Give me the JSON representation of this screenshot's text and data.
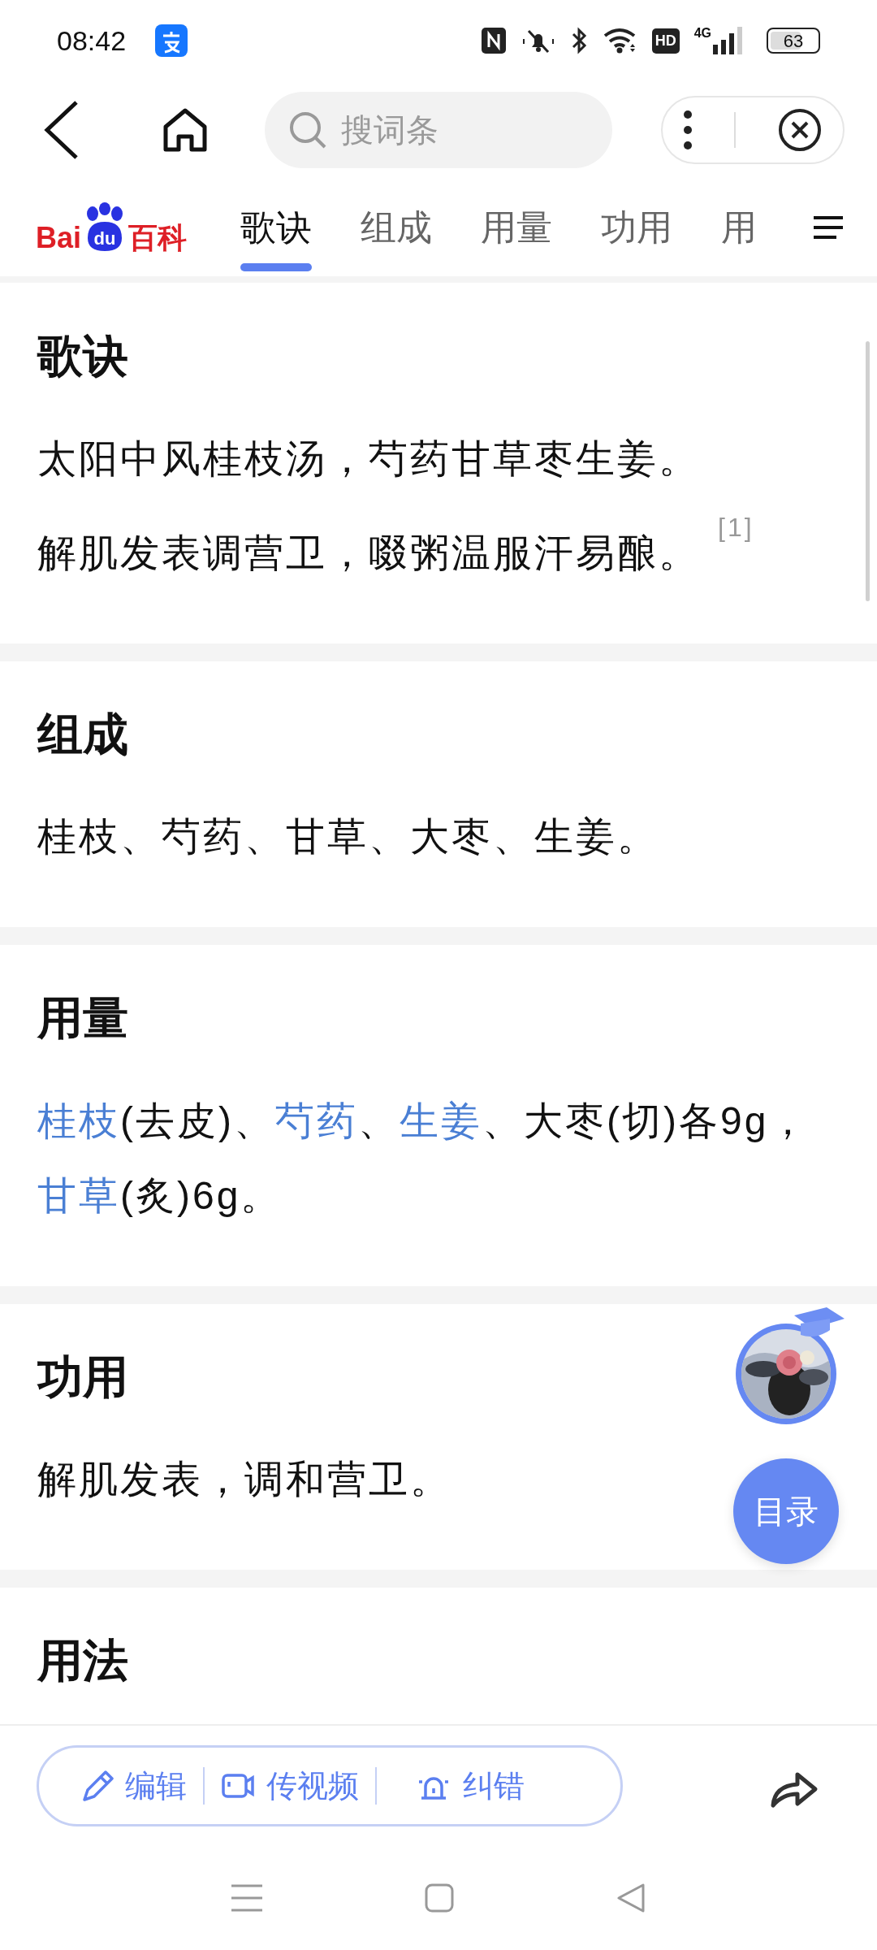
{
  "status_bar": {
    "time": "08:42",
    "hd_label": "HD",
    "network_label": "4G",
    "battery": "63"
  },
  "header": {
    "search": {
      "placeholder": "搜词条"
    }
  },
  "logo": {
    "left": "Bai",
    "paw": "du",
    "right": "百科"
  },
  "tabs": [
    {
      "label": "歌诀",
      "selected": true
    },
    {
      "label": "组成",
      "selected": false
    },
    {
      "label": "用量",
      "selected": false
    },
    {
      "label": "功用",
      "selected": false
    },
    {
      "label": "用",
      "selected": false
    }
  ],
  "sections": [
    {
      "title": "歌诀",
      "paragraphs": [
        {
          "parts": [
            {
              "kind": "text",
              "text": "太阳中风桂枝汤，芍药甘草枣生姜。"
            }
          ]
        },
        {
          "parts": [
            {
              "kind": "text",
              "text": "解肌发表调营卫，啜粥温服汗易酿。"
            },
            {
              "kind": "ref",
              "text": "[1]"
            }
          ]
        }
      ]
    },
    {
      "title": "组成",
      "paragraphs": [
        {
          "parts": [
            {
              "kind": "text",
              "text": "桂枝、芍药、甘草、大枣、生姜。"
            }
          ]
        }
      ]
    },
    {
      "title": "用量",
      "paragraphs": [
        {
          "parts": [
            {
              "kind": "link",
              "text": "桂枝"
            },
            {
              "kind": "text",
              "text": "(去皮)、"
            },
            {
              "kind": "link",
              "text": "芍药"
            },
            {
              "kind": "text",
              "text": "、"
            },
            {
              "kind": "link",
              "text": "生姜"
            },
            {
              "kind": "text",
              "text": "、大枣(切)各9g，"
            },
            {
              "kind": "link",
              "text": "甘草"
            },
            {
              "kind": "text",
              "text": "(炙)6g。"
            }
          ]
        }
      ]
    },
    {
      "title": "功用",
      "paragraphs": [
        {
          "parts": [
            {
              "kind": "text",
              "text": "解肌发表，调和营卫。"
            }
          ]
        }
      ]
    },
    {
      "title": "用法"
    }
  ],
  "toc_button": "目录",
  "toolbar": {
    "actions": [
      "编辑",
      "传视频",
      "纠错"
    ]
  }
}
